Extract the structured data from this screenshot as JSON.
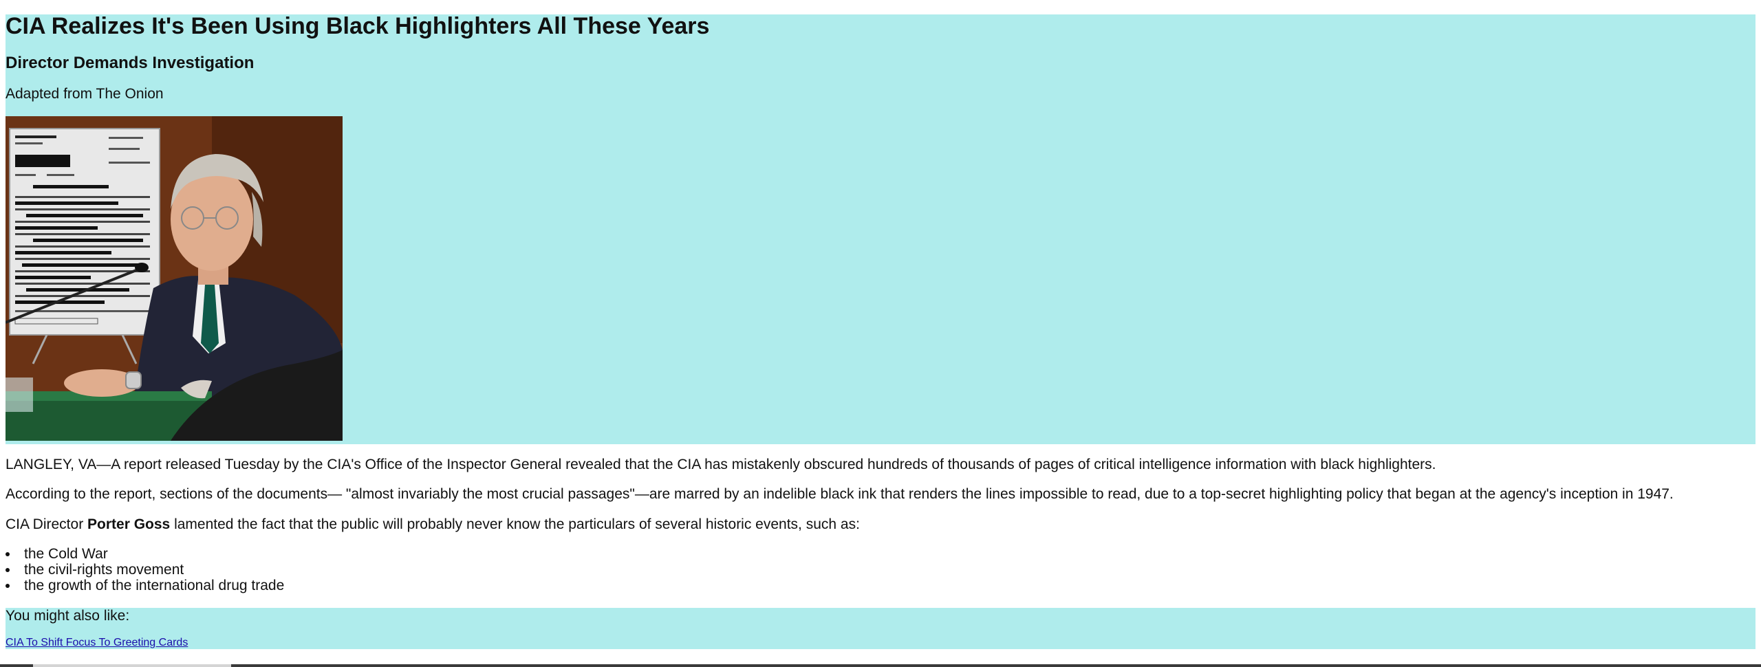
{
  "article": {
    "headline": "CIA Realizes It's Been Using Black Highlighters All These Years",
    "subheadline": "Director Demands Investigation",
    "source": "Adapted from The Onion",
    "paragraph1": "LANGLEY, VA—A report released Tuesday by the CIA's Office of the Inspector General revealed that the CIA has mistakenly obscured hundreds of thousands of pages of critical intelligence information with black highlighters.",
    "paragraph2": "According to the report, sections of the documents— \"almost invariably the most crucial passages\"—are marred by an indelible black ink that renders the lines impossible to read, due to a top-secret highlighting policy that began at the agency's inception in 1947.",
    "paragraph3": {
      "before": "CIA Director ",
      "name": "Porter Goss",
      "after": " lamented the fact that the public will probably never know the particulars of several historic events, such as:"
    },
    "events": [
      "the Cold War",
      "the civil-rights movement",
      "the growth of the international drug trade"
    ]
  },
  "related": {
    "heading": "You might also like:",
    "link_label": "CIA To Shift Focus To Greeting Cards"
  },
  "colors": {
    "highlight_background": "#afecec",
    "link": "#1a0dab",
    "text": "#111111"
  }
}
